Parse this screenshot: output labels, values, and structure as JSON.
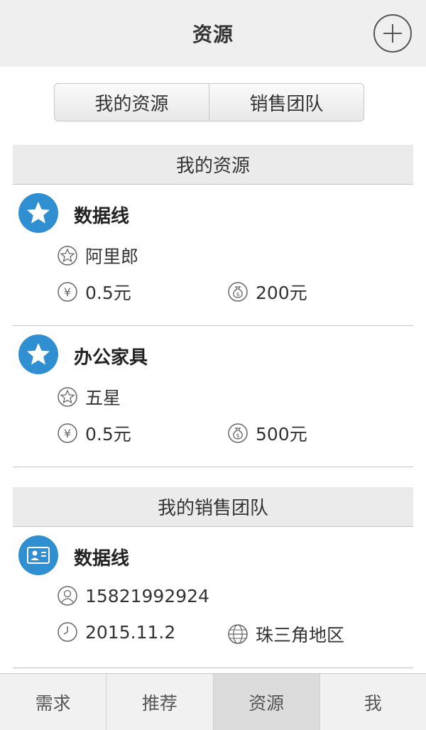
{
  "header": {
    "title": "资源",
    "add_icon": "plus-circle-icon"
  },
  "segment": {
    "left_label": "我的资源",
    "right_label": "销售团队"
  },
  "resources_section": {
    "title": "我的资源"
  },
  "resources": [
    {
      "name": "数据线",
      "rating": "阿里郎",
      "price": "0.5元",
      "amount": "200元"
    },
    {
      "name": "办公家具",
      "rating": "五星",
      "price": "0.5元",
      "amount": "500元"
    }
  ],
  "team_section": {
    "title": "我的销售团队"
  },
  "team": [
    {
      "name": "数据线",
      "phone": "15821992924",
      "date": "2015.11.2",
      "region": "珠三角地区"
    }
  ],
  "tabbar": {
    "items": [
      {
        "label": "需求"
      },
      {
        "label": "推荐"
      },
      {
        "label": "资源"
      },
      {
        "label": "我"
      }
    ],
    "active_index": 2
  },
  "colors": {
    "accent": "#2f8fd0",
    "header_bg": "#efefef",
    "text": "#333333"
  }
}
